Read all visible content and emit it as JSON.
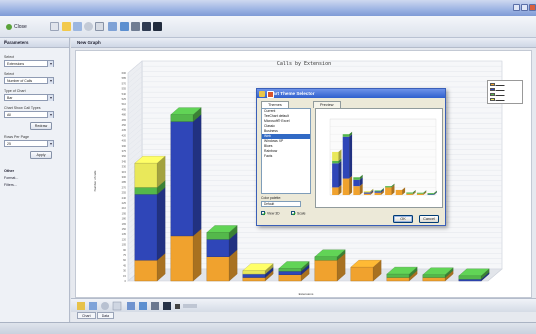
{
  "window": {
    "title": ""
  },
  "toolbar": {
    "close_label": "Close"
  },
  "parameters": {
    "header": "Parameters",
    "fields": [
      {
        "label": "Select",
        "value": "Extensions"
      },
      {
        "label": "Select",
        "value": "Number of Calls"
      },
      {
        "label": "Type of Chart",
        "value": "Bar"
      },
      {
        "label": "Chart Show Call Types",
        "value": "All"
      }
    ],
    "redraw_label": "Redraw",
    "rows_label": "Rows Per Page",
    "rows_value": "25",
    "apply_label": "Apply",
    "other_title": "Other",
    "links": [
      "Format...",
      "Filters..."
    ]
  },
  "main": {
    "tab_label": "New Graph"
  },
  "bottom_tabs": [
    "Chart",
    "Data"
  ],
  "chart_data": {
    "type": "bar",
    "title": "Calls by Extension",
    "xlabel": "Extensions",
    "ylabel": "Number of calls",
    "categories": [
      "",
      "",
      "",
      "",
      "",
      "",
      "",
      "",
      "",
      ""
    ],
    "series": [
      {
        "name": "",
        "color": "#f0a22e",
        "values": [
          60,
          130,
          70,
          10,
          18,
          60,
          40,
          10,
          10,
          0
        ]
      },
      {
        "name": "",
        "color": "#2f46b8",
        "values": [
          190,
          330,
          50,
          10,
          10,
          0,
          0,
          0,
          0,
          5
        ]
      },
      {
        "name": "",
        "color": "#54b84b",
        "values": [
          20,
          20,
          20,
          0,
          8,
          10,
          0,
          10,
          8,
          10
        ]
      },
      {
        "name": "",
        "color": "#e9e85a",
        "values": [
          70,
          0,
          0,
          10,
          0,
          0,
          0,
          0,
          0,
          0
        ]
      }
    ],
    "ylim": [
      0,
      600
    ],
    "grid": true,
    "legend": "right"
  },
  "legend": {
    "colors": [
      "#f0a22e",
      "#2f46b8",
      "#54b84b",
      "#e9e85a"
    ]
  },
  "dialog": {
    "title": "Chart Theme Selector",
    "tabs": [
      "Themes",
      "Preview"
    ],
    "themes": [
      "Current",
      "TeeChart default",
      "Microsoft® Excel",
      "Classic",
      "Business",
      "Web",
      "Windows XP",
      "Blues",
      "Rainbow",
      "Facts"
    ],
    "selected_index": 5,
    "palette_label": "Color palette:",
    "palette_value": "Default",
    "view3d_label": "View 3D",
    "scale_label": "Scale",
    "ok_label": "OK",
    "cancel_label": "Cancel"
  },
  "icons": [
    "close-icon",
    "refresh-icon",
    "open-icon",
    "save-icon",
    "print-icon",
    "zoom-icon",
    "copy-icon",
    "chart-icon",
    "export-icon"
  ]
}
